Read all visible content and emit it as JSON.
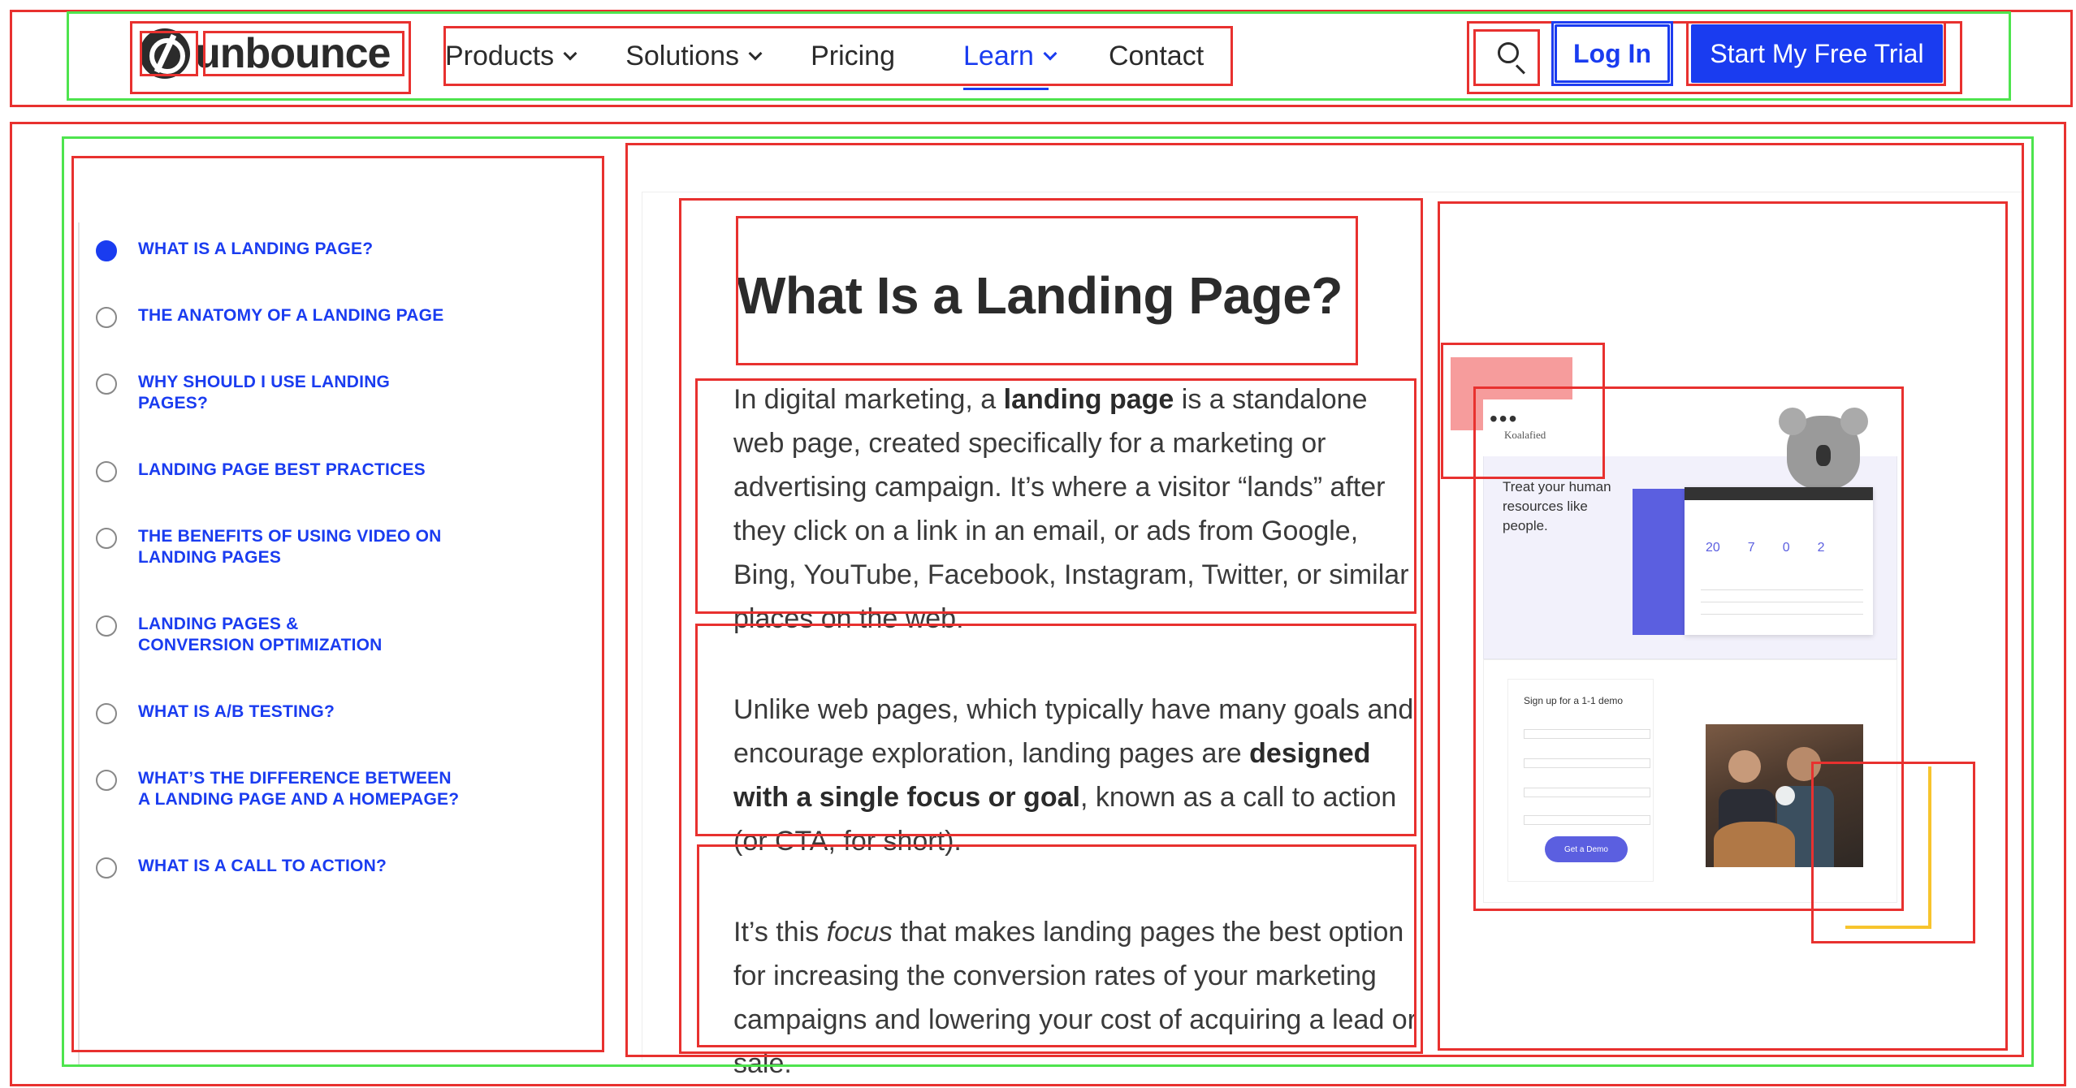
{
  "header": {
    "logo_text": "unbounce",
    "nav": [
      {
        "label": "Products",
        "has_dropdown": true
      },
      {
        "label": "Solutions",
        "has_dropdown": true
      },
      {
        "label": "Pricing",
        "has_dropdown": false
      },
      {
        "label": "Learn",
        "has_dropdown": true,
        "active": true
      },
      {
        "label": "Contact",
        "has_dropdown": false
      }
    ],
    "search_icon": "search-icon",
    "login_label": "Log In",
    "trial_label": "Start My Free Trial"
  },
  "toc": {
    "items": [
      {
        "label": "WHAT IS A LANDING PAGE?",
        "active": true
      },
      {
        "label": "THE ANATOMY OF A LANDING PAGE",
        "active": false
      },
      {
        "label": "WHY SHOULD I USE LANDING PAGES?",
        "active": false
      },
      {
        "label": "LANDING PAGE BEST PRACTICES",
        "active": false
      },
      {
        "label": "THE BENEFITS OF USING VIDEO ON LANDING PAGES",
        "active": false
      },
      {
        "label": "LANDING PAGES & CONVERSION OPTIMIZATION",
        "active": false
      },
      {
        "label": "WHAT IS A/B TESTING?",
        "active": false
      },
      {
        "label": "WHAT’S THE DIFFERENCE BETWEEN A LANDING PAGE AND A HOMEPAGE?",
        "active": false
      },
      {
        "label": "WHAT IS A CALL TO ACTION?",
        "active": false
      }
    ]
  },
  "article": {
    "title": "What Is a Landing Page?",
    "p1": {
      "before": "In digital marketing, a ",
      "bold": "landing page",
      "after": " is a standalone web page, created specifically for a marketing or advertising campaign. It’s where a visitor “lands” after they click on a link in an email, or ads from Google, Bing, YouTube, Facebook, Instagram, Twitter, or similar places on the web."
    },
    "p2": {
      "before": "Unlike web pages, which typically have many goals and encourage exploration, landing pages are ",
      "bold": "designed with a single focus or goal",
      "after": ", known as a call to action (or CTA, for short)."
    },
    "p3": {
      "before": "It’s this ",
      "italic": "focus",
      "after": " that makes landing pages the best option for increasing the conversion rates of your marketing campaigns and lowering your cost of acquiring a lead or sale."
    }
  },
  "illustration": {
    "brand": "Koalafied",
    "tagline": "Treat your human resources like people.",
    "stats": [
      "20",
      "7",
      "0",
      "2"
    ],
    "form_title": "Sign up for a 1-1 demo",
    "form_button": "Get a Demo"
  },
  "colors": {
    "accent": "#1a3cf0",
    "text": "#2b2b2b"
  }
}
